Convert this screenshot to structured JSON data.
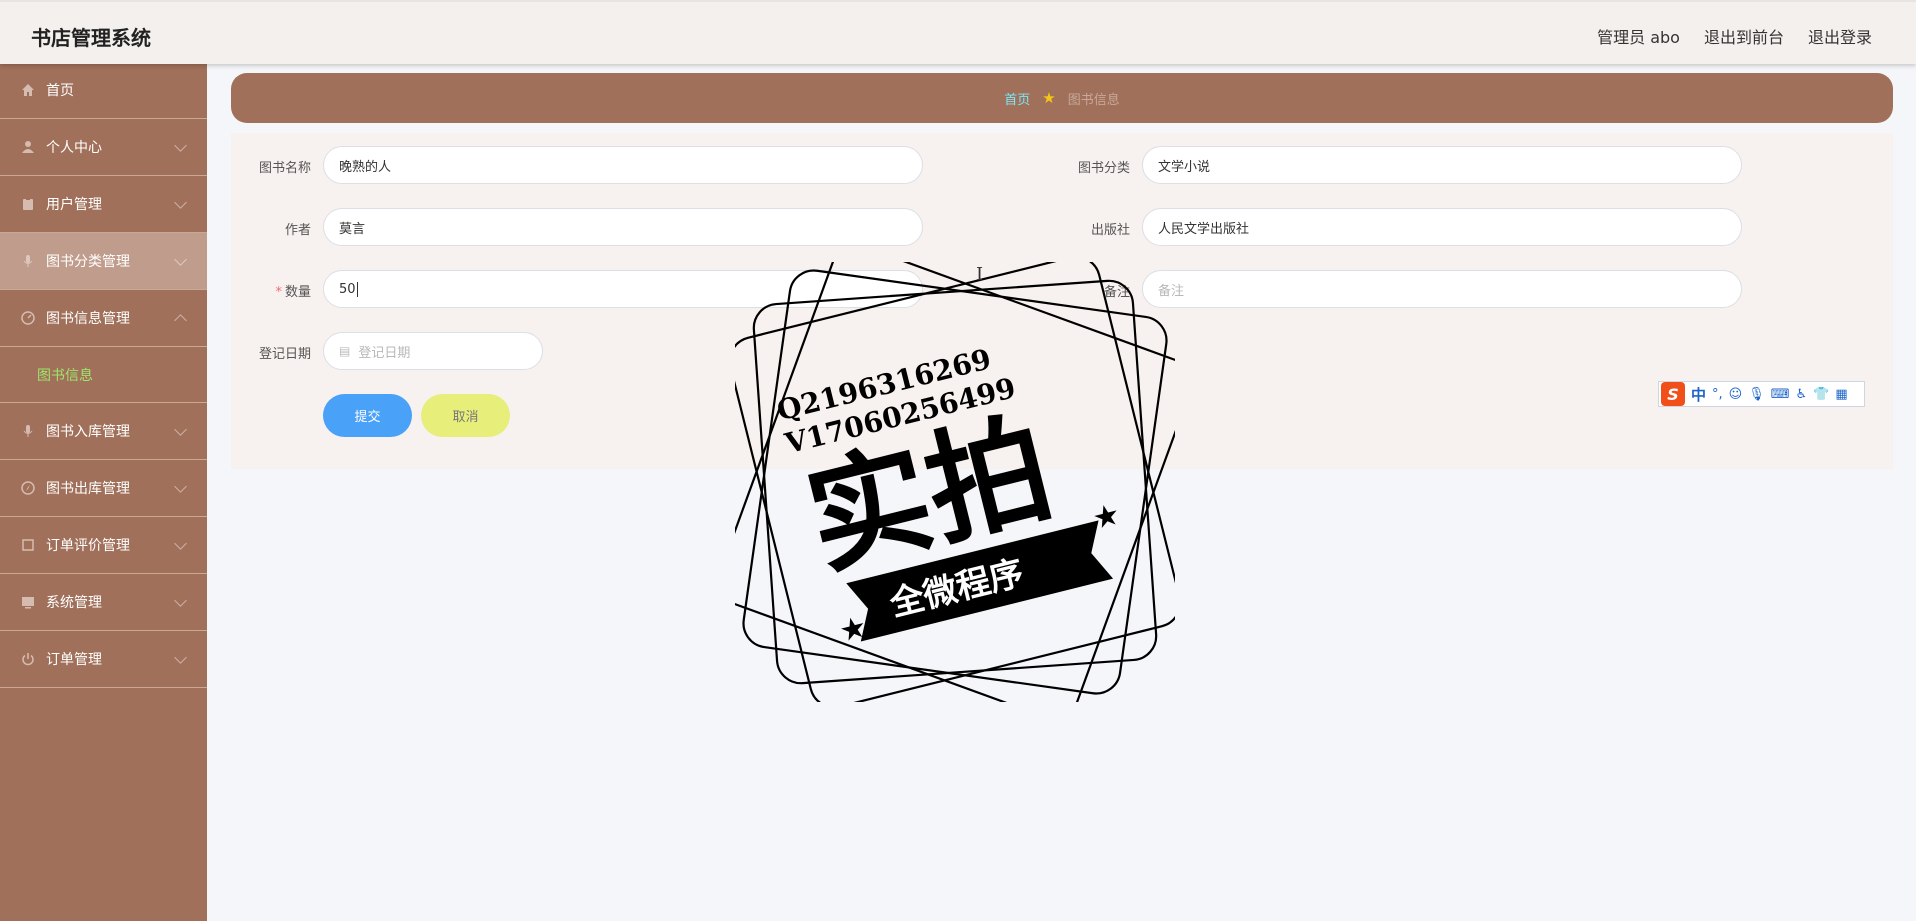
{
  "header": {
    "title": "书店管理系统",
    "admin": "管理员 abo",
    "to_front": "退出到前台",
    "logout": "退出登录"
  },
  "sidebar": {
    "items": [
      {
        "label": "首页",
        "icon": "home-icon"
      },
      {
        "label": "个人中心",
        "icon": "user-icon"
      },
      {
        "label": "用户管理",
        "icon": "clipboard-icon"
      },
      {
        "label": "图书分类管理",
        "icon": "mic-icon"
      },
      {
        "label": "图书信息管理",
        "icon": "dashboard-icon"
      },
      {
        "label": "图书入库管理",
        "icon": "mic-icon"
      },
      {
        "label": "图书出库管理",
        "icon": "compass-icon"
      },
      {
        "label": "订单评价管理",
        "icon": "crop-icon"
      },
      {
        "label": "系统管理",
        "icon": "monitor-icon"
      },
      {
        "label": "订单管理",
        "icon": "power-icon"
      }
    ],
    "sub_item": "图书信息"
  },
  "breadcrumb": {
    "home": "首页",
    "current": "图书信息"
  },
  "form": {
    "book_name_label": "图书名称",
    "book_name_value": "晚熟的人",
    "category_label": "图书分类",
    "category_value": "文学小说",
    "author_label": "作者",
    "author_value": "莫言",
    "publisher_label": "出版社",
    "publisher_value": "人民文学出版社",
    "quantity_label": "数量",
    "quantity_value": "50",
    "remark_label": "备注",
    "remark_placeholder": "备注",
    "date_label": "登记日期",
    "date_placeholder": "登记日期",
    "submit": "提交",
    "cancel": "取消"
  },
  "ime": {
    "lang": "中",
    "punct": "°,"
  },
  "watermark": {
    "line1": "Q2196316269",
    "line2": "V17060256499",
    "big": "实拍",
    "ribbon": "全微程序"
  },
  "colors": {
    "sidebar": "#a0705a",
    "header": "#f4f0ee",
    "submit": "#4aa1f8",
    "cancel": "#e7ee7a",
    "sub_active": "#9fe66a",
    "breadcrumb_home": "#7ee6f4"
  }
}
